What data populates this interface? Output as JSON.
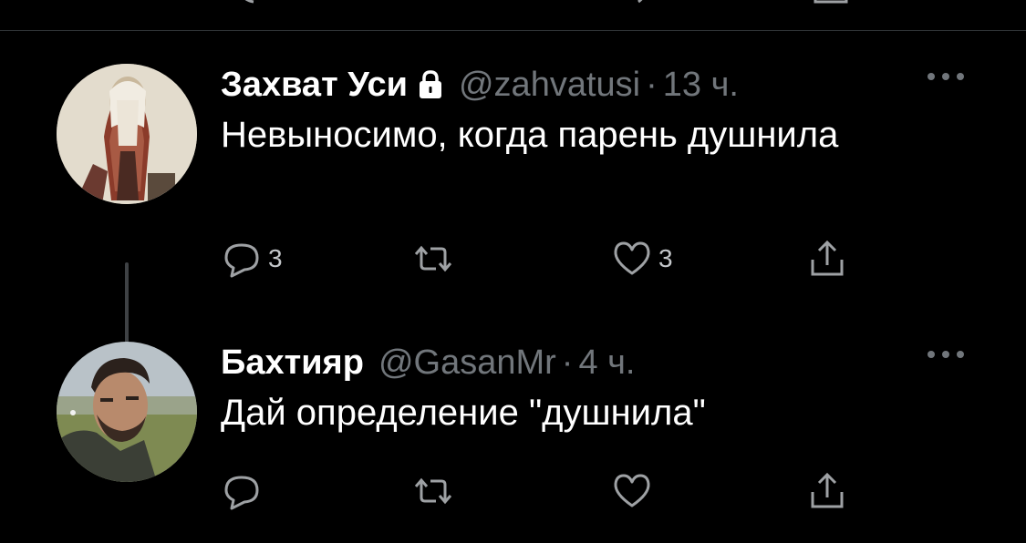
{
  "colors": {
    "background": "#000000",
    "text": "#ffffff",
    "secondary": "#71767b",
    "icon": "#9ea1a4",
    "divider": "#2f3336",
    "thread_line": "#3e4144"
  },
  "tweets": [
    {
      "display_name": "Захват Уси",
      "protected": true,
      "handle": "@zahvatusi",
      "separator": "·",
      "time": "13 ч.",
      "text": "Невыносимо, когда парень душнила",
      "reply_count": "3",
      "retweet_count": "",
      "like_count": "3",
      "icons": {
        "lock": "lock-icon",
        "more": "more-icon",
        "reply": "reply-icon",
        "retweet": "retweet-icon",
        "like": "heart-icon",
        "share": "share-icon"
      }
    },
    {
      "display_name": "Бахтияр",
      "protected": false,
      "handle": "@GasanMr",
      "separator": "·",
      "time": "4 ч.",
      "text": "Дай определение \"душнила\"",
      "reply_count": "",
      "retweet_count": "",
      "like_count": "",
      "icons": {
        "more": "more-icon",
        "reply": "reply-icon",
        "retweet": "retweet-icon",
        "like": "heart-icon",
        "share": "share-icon"
      }
    }
  ]
}
